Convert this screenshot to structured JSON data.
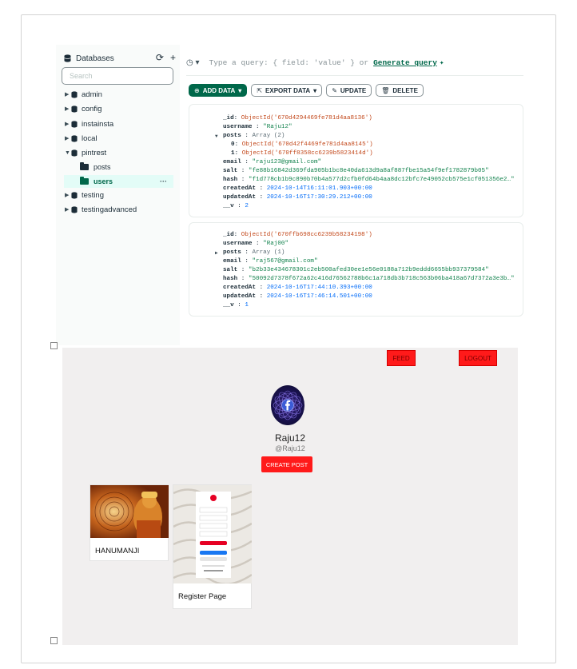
{
  "compass": {
    "sidebar": {
      "title": "Databases",
      "search_placeholder": "Search",
      "databases": [
        {
          "name": "admin",
          "expanded": false
        },
        {
          "name": "config",
          "expanded": false
        },
        {
          "name": "instainsta",
          "expanded": false
        },
        {
          "name": "local",
          "expanded": false
        },
        {
          "name": "pintrest",
          "expanded": true,
          "collections": [
            "posts",
            "users"
          ]
        },
        {
          "name": "testing",
          "expanded": false
        },
        {
          "name": "testingadvanced",
          "expanded": false
        }
      ],
      "selected_collection": "users",
      "more_glyph": "···"
    },
    "query": {
      "placeholder": "Type a query: { field: 'value' } or",
      "generate_link": "Generate query"
    },
    "toolbar": {
      "add_data": "ADD DATA",
      "export_data": "EXPORT DATA",
      "update": "UPDATE",
      "delete": "DELETE"
    },
    "documents": [
      {
        "_id": "ObjectId('670d4294469fe781d4aa8136')",
        "username": "\"Raju12\"",
        "posts_label": "Array (2)",
        "posts_items": [
          "ObjectId('670d42f4469fe781d4aa8145')",
          "ObjectId('670ff8358cc6239b5823414d')"
        ],
        "email": "\"raju123@gmail.com\"",
        "salt": "\"fe88b16842d369fda905b1bc8e40da613d9a8af887fbe15a54f9ef1782879b05\"",
        "hash": "\"f1d778cb1b9c890b70b4a577d2cfb0fd64b4aa8dc12bfc7e49052cb575e1cf051356e2…\"",
        "createdAt": "2024-10-14T16:11:01.903+00:00",
        "updatedAt": "2024-10-16T17:30:29.212+00:00",
        "__v": "2"
      },
      {
        "_id": "ObjectId('670ffb698cc6239b58234198')",
        "username": "\"Raj00\"",
        "posts_label": "Array (1)",
        "email": "\"raj567@gmail.com\"",
        "salt": "\"b2b33e434678301c2eb500afed30ee1e56e0188a712b9eddd6655bb937379584\"",
        "hash": "\"50092d7378f672a62c416d76562788b6c1a718db3b718c563b06ba418a67d7372a3e3b…\"",
        "createdAt": "2024-10-16T17:44:10.393+00:00",
        "updatedAt": "2024-10-16T17:46:14.501+00:00",
        "__v": "1"
      }
    ]
  },
  "app": {
    "nav": {
      "feed": "FEED",
      "logout": "LOGOUT"
    },
    "profile": {
      "name": "Raju12",
      "handle": "@Raju12",
      "create_button": "CREATE POST"
    },
    "posts": [
      {
        "caption": "HANUMANJI"
      },
      {
        "caption": "Register Page"
      }
    ]
  },
  "colors": {
    "compass_green": "#00684a",
    "selected_bg": "#e3fcf7",
    "app_red": "#ff1a1a",
    "app_bg": "#f1efef"
  }
}
